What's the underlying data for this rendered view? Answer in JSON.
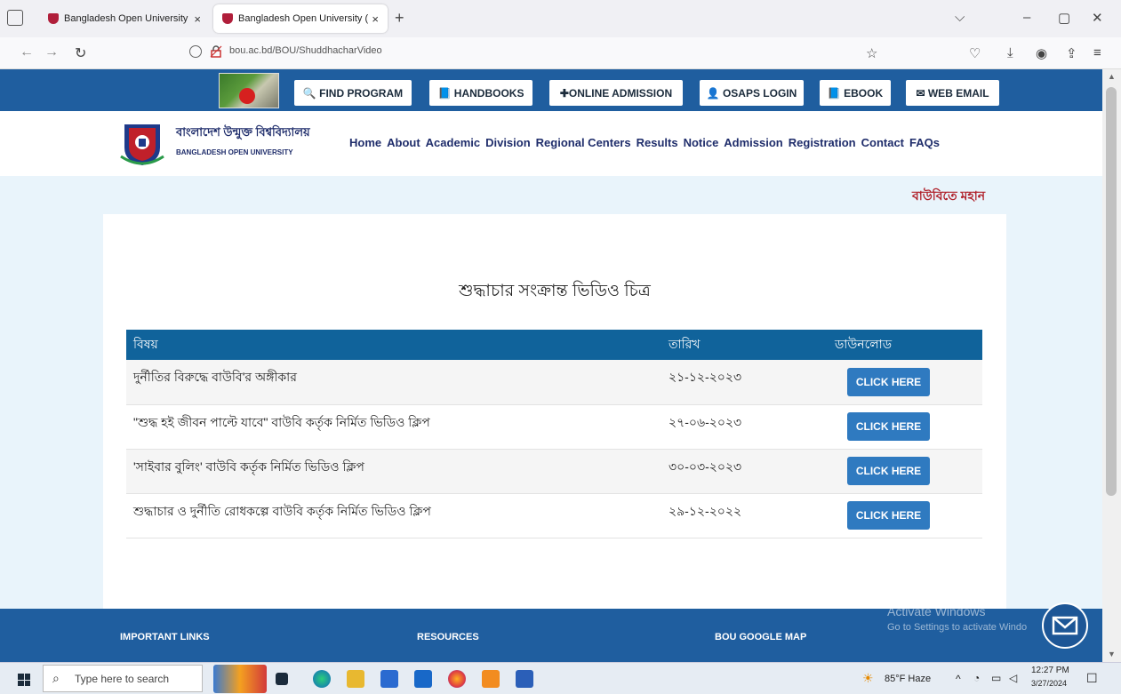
{
  "browser": {
    "tabs": [
      {
        "title": "Bangladesh Open University (B",
        "close": "×"
      },
      {
        "title": "Bangladesh Open University (B",
        "close": "×"
      }
    ],
    "new_tab": "+",
    "url": "bou.ac.bd/BOU/ShuddhacharVideo"
  },
  "topbar": {
    "buttons": [
      {
        "label": "🔍 FIND PROGRAM"
      },
      {
        "label": "📘 HANDBOOKS"
      },
      {
        "label": "✚ONLINE ADMISSION"
      },
      {
        "label": "👤 OSAPS LOGIN"
      },
      {
        "label": "📘 EBOOK"
      },
      {
        "label": "✉ WEB EMAIL"
      }
    ]
  },
  "header": {
    "brand_bn": "বাংলাদেশ উন্মুক্ত বিশ্ববিদ্যালয়",
    "brand_en": "BANGLADESH OPEN UNIVERSITY",
    "nav": [
      "Home",
      "About",
      "Academic",
      "Division",
      "Regional Centers",
      "Results",
      "Notice",
      "Admission",
      "Registration",
      "Contact",
      "FAQs"
    ]
  },
  "marquee": "বাউবিতে মহান",
  "main": {
    "title": "শুদ্ধাচার সংক্রান্ত ভিডিও চিত্র",
    "table": {
      "headers": [
        "বিষয়",
        "তারিখ",
        "ডাউনলোড"
      ],
      "rows": [
        {
          "subject": "দুর্নীতির বিরুদ্ধে বাউবি'র অঙ্গীকার",
          "date": "২১-১২-২০২৩",
          "button": "CLICK HERE"
        },
        {
          "subject": "\"শুদ্ধ হই জীবন পাল্টে যাবে\" বাউবি কর্তৃক নির্মিত ভিডিও ক্লিপ",
          "date": "২৭-০৬-২০২৩",
          "button": "CLICK HERE"
        },
        {
          "subject": "'সাইবার বুলিং' বাউবি কর্তৃক নির্মিত ভিডিও ক্লিপ",
          "date": "৩০-০৩-২০২৩",
          "button": "CLICK HERE"
        },
        {
          "subject": "শুদ্ধাচার ও দুর্নীতি রোধকল্পে বাউবি কর্তৃক নির্মিত ভিডিও ক্লিপ",
          "date": "২৯-১২-২০২২",
          "button": "CLICK HERE"
        }
      ]
    }
  },
  "footer": {
    "links": [
      "IMPORTANT LINKS",
      "RESOURCES",
      "BOU GOOGLE MAP"
    ],
    "activate_title": "Activate Windows",
    "activate_sub": "Go to Settings to activate Windo"
  },
  "taskbar": {
    "search_placeholder": "Type here to search",
    "weather": "85°F Haze",
    "time": "12:27 PM",
    "date": "3/27/2024"
  }
}
